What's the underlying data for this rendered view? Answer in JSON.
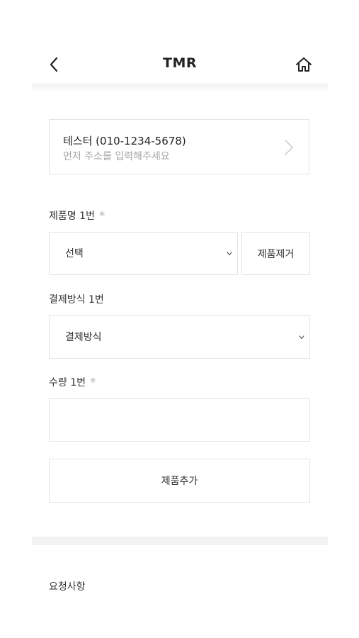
{
  "header": {
    "title": "TMR",
    "back_icon": "chevron-left-icon",
    "home_icon": "home-icon"
  },
  "address": {
    "name": "테스터 (010-1234-5678)",
    "hint": "먼저 주소를 입력해주세요",
    "arrow_icon": "chevron-right-icon"
  },
  "products": [
    {
      "product_label": "제품명 1번",
      "required_mark": "*",
      "product_select": "선택",
      "remove_label": "제품제거",
      "payment_label": "결제방식 1번",
      "payment_select": "결제방식",
      "quantity_label": "수량 1번",
      "quantity_value": ""
    }
  ],
  "add_product_label": "제품추가",
  "request_label": "요청사항",
  "colors": {
    "border": "#e3e3e3",
    "hint_text": "#a6a6a6",
    "required_mark": "#b5b5b5",
    "divider": "#f3f3f3"
  }
}
